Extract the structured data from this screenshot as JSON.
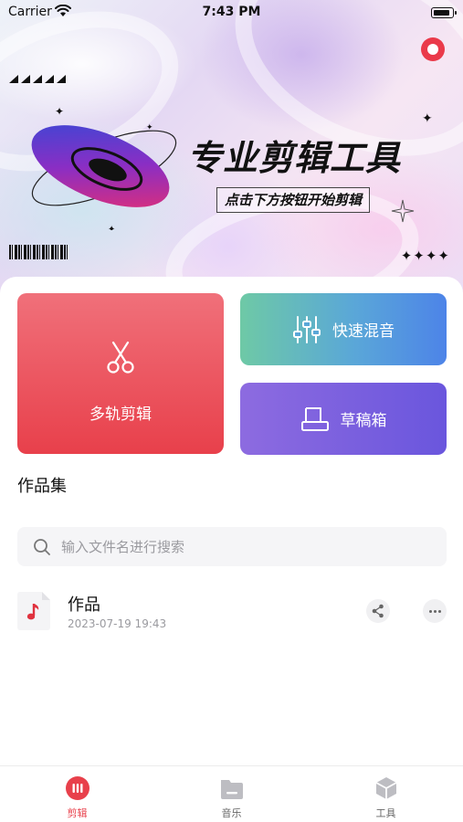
{
  "status_bar": {
    "carrier": "Carrier",
    "time": "7:43 PM"
  },
  "hero": {
    "title": "专业剪辑工具",
    "subtitle": "点击下方按钮开始剪辑",
    "decoration": "✦✦✦✦"
  },
  "actions": {
    "multitrack_label": "多轨剪辑",
    "quick_mix_label": "快速混音",
    "drafts_label": "草稿箱"
  },
  "works": {
    "section_title": "作品集",
    "search_placeholder": "输入文件名进行搜索",
    "items": [
      {
        "name": "作品",
        "date": "2023-07-19 19:43",
        "icon": "music-note-icon"
      }
    ]
  },
  "tab_bar": {
    "tabs": [
      {
        "label": "剪辑",
        "icon": "edit-icon",
        "active": true
      },
      {
        "label": "音乐",
        "icon": "folder-icon",
        "active": false
      },
      {
        "label": "工具",
        "icon": "cube-icon",
        "active": false
      }
    ]
  },
  "colors": {
    "accent": "#e8404b",
    "multitrack_card": "#ec5862",
    "quick_mix_card": "#5aa7d8",
    "drafts_card": "#7a5fe0"
  }
}
